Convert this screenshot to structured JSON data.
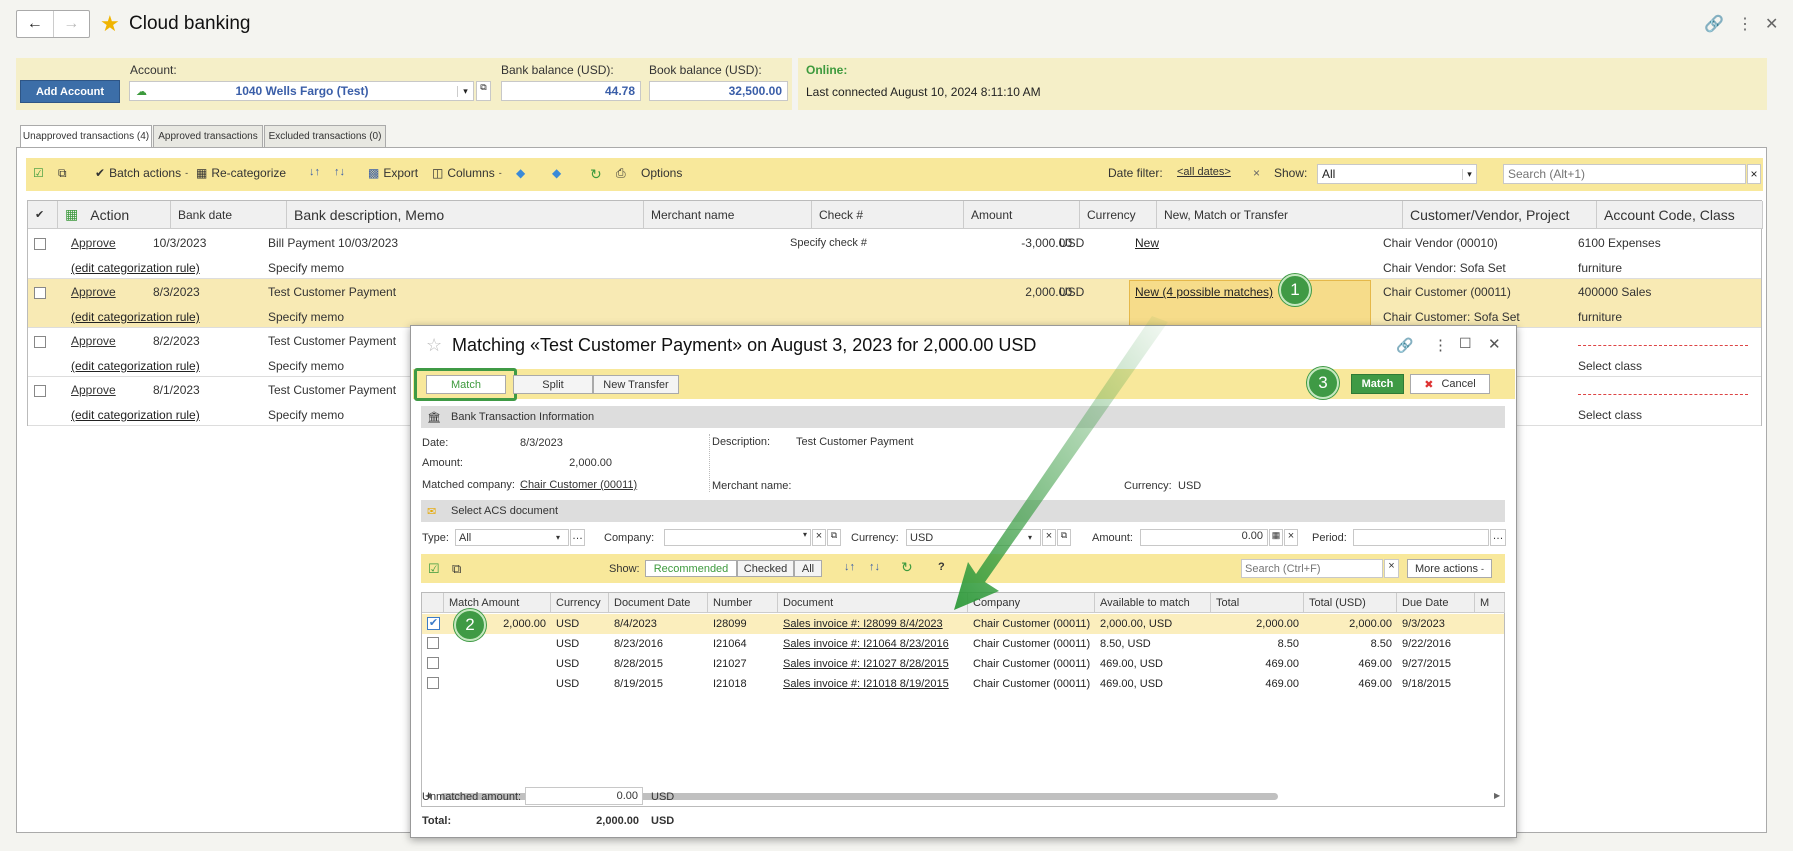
{
  "header": {
    "title": "Cloud banking"
  },
  "account": {
    "add_label": "Add Account",
    "account_label": "Account:",
    "account_value": "1040 Wells Fargo (Test)",
    "bank_balance_label": "Bank balance (USD):",
    "bank_balance": "44.78",
    "book_balance_label": "Book balance (USD):",
    "book_balance": "32,500.00",
    "online_label": "Online:",
    "last_connected": "Last connected August 10, 2024 8:11:10 AM"
  },
  "tabs": [
    "Unapproved transactions (4)",
    "Approved transactions",
    "Excluded transactions (0)"
  ],
  "toolbar": {
    "batch": "Batch actions",
    "recat": "Re-categorize",
    "export": "Export",
    "columns": "Columns",
    "options": "Options",
    "date_filter_label": "Date filter:",
    "date_filter": "<all dates>",
    "show_label": "Show:",
    "show_value": "All",
    "search_placeholder": "Search (Alt+1)"
  },
  "grid": {
    "headers": [
      "Action",
      "Bank date",
      "Bank description, Memo",
      "Merchant name",
      "Check #",
      "Amount",
      "Currency",
      "New, Match or Transfer",
      "Customer/Vendor, Project",
      "Account Code, Class"
    ],
    "rows": [
      {
        "action": "Approve",
        "rule": "(edit categorization rule)",
        "date": "10/3/2023",
        "desc": "Bill Payment 10/03/2023",
        "memo": "Specify memo",
        "check": "Specify check #",
        "amount": "-3,000.00",
        "currency": "USD",
        "match": "New",
        "cv": "Chair Vendor (00010)",
        "project": "Chair Vendor: Sofa Set",
        "acct": "6100 Expenses",
        "cls": "furniture"
      },
      {
        "action": "Approve",
        "rule": "(edit categorization rule)",
        "date": "8/3/2023",
        "desc": "Test Customer Payment",
        "memo": "Specify memo",
        "check": "",
        "amount": "2,000.00",
        "currency": "USD",
        "match": "New (4 possible matches)",
        "cv": "Chair Customer (00011)",
        "project": "Chair Customer: Sofa Set",
        "acct": "400000 Sales",
        "cls": "furniture"
      },
      {
        "action": "Approve",
        "rule": "(edit categorization rule)",
        "date": "8/2/2023",
        "desc": "Test Customer Payment",
        "memo": "Specify memo",
        "cls": "Select class"
      },
      {
        "action": "Approve",
        "rule": "(edit categorization rule)",
        "date": "8/1/2023",
        "desc": "Test Customer Payment",
        "memo": "Specify memo",
        "cls": "Select class"
      }
    ]
  },
  "dialog": {
    "title": "Matching «Test Customer Payment» on August 3, 2023 for 2,000.00 USD",
    "tabs": [
      "Match",
      "Split",
      "New Transfer"
    ],
    "match_btn": "Match",
    "cancel_btn": "Cancel",
    "bank_info": "Bank Transaction Information",
    "date_label": "Date:",
    "date": "8/3/2023",
    "amount_label": "Amount:",
    "amount": "2,000.00",
    "matched_label": "Matched company:",
    "matched": "Chair Customer (00011)",
    "desc_label": "Description:",
    "desc": "Test Customer Payment",
    "merchant_label": "Merchant name:",
    "currency_label": "Currency:",
    "currency": "USD",
    "select_doc": "Select ACS document",
    "type_label": "Type:",
    "type": "All",
    "company_label": "Company:",
    "fcurrency_label": "Currency:",
    "fcurrency": "USD",
    "famount_label": "Amount:",
    "famount": "0.00",
    "period_label": "Period:",
    "show_label": "Show:",
    "show_opts": [
      "Recommended",
      "Checked",
      "All"
    ],
    "search_placeholder": "Search (Ctrl+F)",
    "more_actions": "More actions",
    "headers": [
      "Match Amount",
      "Currency",
      "Document Date",
      "Number",
      "Document",
      "Company",
      "Available to match",
      "Total",
      "Total (USD)",
      "Due Date",
      "M"
    ],
    "rows": [
      {
        "checked": true,
        "match": "2,000.00",
        "cur": "USD",
        "date": "8/4/2023",
        "num": "I28099",
        "doc": "Sales invoice #: I28099 8/4/2023",
        "comp": "Chair Customer (00011)",
        "avail": "2,000.00, USD",
        "total": "2,000.00",
        "usd": "2,000.00",
        "due": "9/3/2023"
      },
      {
        "checked": false,
        "match": "",
        "cur": "USD",
        "date": "8/23/2016",
        "num": "I21064",
        "doc": "Sales invoice #: I21064 8/23/2016",
        "comp": "Chair Customer (00011)",
        "avail": "8.50, USD",
        "total": "8.50",
        "usd": "8.50",
        "due": "9/22/2016"
      },
      {
        "checked": false,
        "match": "",
        "cur": "USD",
        "date": "8/28/2015",
        "num": "I21027",
        "doc": "Sales invoice #: I21027 8/28/2015",
        "comp": "Chair Customer (00011)",
        "avail": "469.00, USD",
        "total": "469.00",
        "usd": "469.00",
        "due": "9/27/2015"
      },
      {
        "checked": false,
        "match": "",
        "cur": "USD",
        "date": "8/19/2015",
        "num": "I21018",
        "doc": "Sales invoice #: I21018 8/19/2015",
        "comp": "Chair Customer (00011)",
        "avail": "469.00, USD",
        "total": "469.00",
        "usd": "469.00",
        "due": "9/18/2015"
      }
    ],
    "unmatched_label": "Unmatched amount:",
    "unmatched": "0.00",
    "unmatched_cur": "USD",
    "total_label": "Total:",
    "total": "2,000.00",
    "total_cur": "USD"
  },
  "badges": [
    "1",
    "2",
    "3"
  ]
}
